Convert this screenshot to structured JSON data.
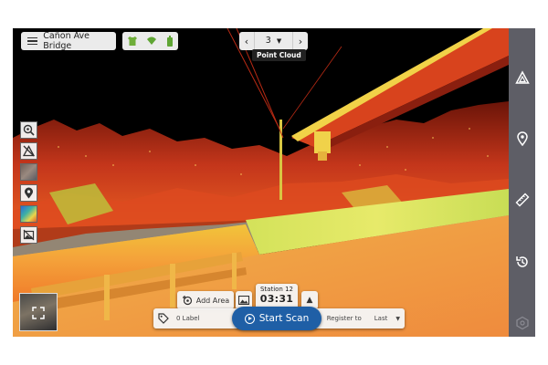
{
  "header": {
    "project_title": "Cañon Ave Bridge",
    "station_nav": {
      "current_station": "3",
      "tooltip": "Point Cloud"
    }
  },
  "status_icons": [
    "shirt-icon",
    "wifi-icon",
    "battery-icon"
  ],
  "left_toolbar": [
    "zoom-view-icon",
    "hide-points-icon",
    "photo-thumbnail",
    "location-pin-icon",
    "color-ramp-icon",
    "image-off-icon"
  ],
  "right_toolbar": [
    "triangle-measure-icon",
    "location-pin-icon",
    "ruler-icon",
    "history-icon",
    "settings-hex-icon"
  ],
  "scan_controls": {
    "add_area_label": "Add Area",
    "station_label": "Station 12",
    "station_time": "03:31",
    "start_scan_label": "Start Scan",
    "label_count": "0 Label",
    "register_to_label": "Register to",
    "register_to_value": "Last"
  },
  "colors": {
    "accent": "#1f5fa6",
    "sidebar": "#5e5e66",
    "panel": "#f5f5f5"
  }
}
